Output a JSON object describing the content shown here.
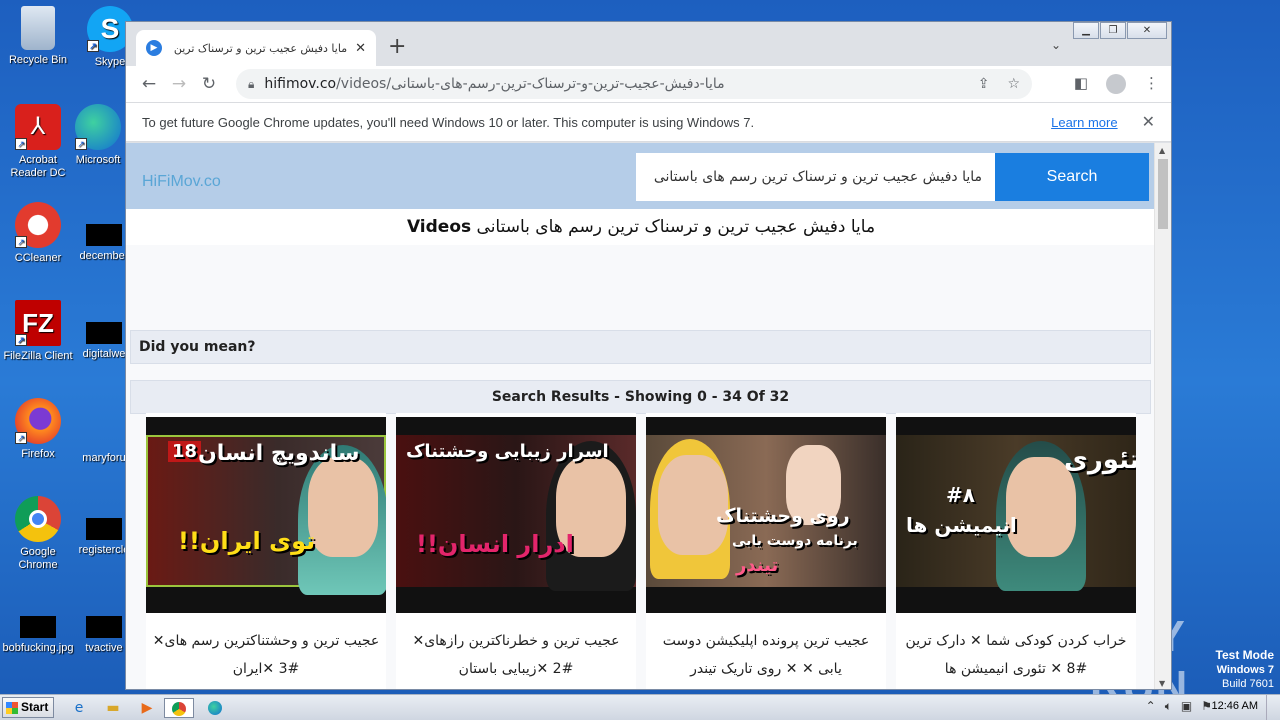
{
  "desktop": {
    "icons": [
      {
        "label": "Recycle Bin",
        "icon": "recycle-bin-icon"
      },
      {
        "label": "Skype",
        "icon": "skype-icon"
      },
      {
        "label": "Acrobat Reader DC",
        "icon": "acrobat-icon"
      },
      {
        "label": "Microsoft",
        "icon": "edge-icon"
      },
      {
        "label": "CCleaner",
        "icon": "ccleaner-icon"
      },
      {
        "label": "december",
        "icon": "file-icon"
      },
      {
        "label": "FileZilla Client",
        "icon": "filezilla-icon"
      },
      {
        "label": "digitalwe",
        "icon": "file-icon"
      },
      {
        "label": "Firefox",
        "icon": "firefox-icon"
      },
      {
        "label": "maryforu",
        "icon": "file-icon"
      },
      {
        "label": "Google Chrome",
        "icon": "chrome-icon"
      },
      {
        "label": "registercle",
        "icon": "file-icon"
      },
      {
        "label": "bobfucking.jpg",
        "icon": "file-icon"
      },
      {
        "label": "tvactive",
        "icon": "file-icon"
      }
    ],
    "watermark": "ANY RUN",
    "test_mode": {
      "line1": "Test Mode",
      "line2": "Windows 7",
      "line3": "Build 7601"
    }
  },
  "browser": {
    "tab_title": "مایا دفیش عجیب ترین و ترسناک ترین",
    "url_host": "hifimov.co",
    "url_path": "/videos/مایا-دفیش-عجیب-ترین-و-ترسناک-ترین-رسم-های-باستانی",
    "infobar": {
      "message": "To get future Google Chrome updates, you'll need Windows 10 or later. This computer is using Windows 7.",
      "link": "Learn more"
    }
  },
  "site": {
    "logo": "HiFiMov.co",
    "search_value": "مایا دفیش عجیب ترین و ترسناک ترین رسم های باستانی",
    "search_button": "Search",
    "heading_prefix": "Videos",
    "heading_text": "مایا دفیش عجیب ترین و ترسناک ترین رسم های باستانی",
    "did_you_mean": "Did you mean?",
    "results_summary": "Search Results - Showing 0 - 34 Of 32",
    "videos": [
      {
        "title": "عجیب ترین و وحشتناکترین رسم های✕ #3 ✕ایران",
        "overlay1": "ساندویچ انسان",
        "overlay2": "توی ایران!!",
        "badge": "18"
      },
      {
        "title": "عجیب ترین و خطرناکترین رازهای✕ #2 ✕زیبایی باستان",
        "overlay1": "اسرار زیبایی وحشتناک",
        "overlay2": "ادرار انسان!!",
        "badge": ""
      },
      {
        "title": "عجیب ترین پرونده اپلیکیشن دوست یابی ✕ ✕ روی تاریک تیندر",
        "overlay1": "روی وحشتناک",
        "overlay2": "برنامه دوست یابی",
        "badge": "تیندر"
      },
      {
        "title": "خراب کردن کودکی شما ✕ دارک ترین #8 ✕ تئوری انیمیشن ها",
        "overlay1": "تئوری",
        "overlay2": "انیمیشن ها",
        "badge": "#۸"
      }
    ]
  },
  "taskbar": {
    "start": "Start",
    "clock": "12:46 AM"
  }
}
